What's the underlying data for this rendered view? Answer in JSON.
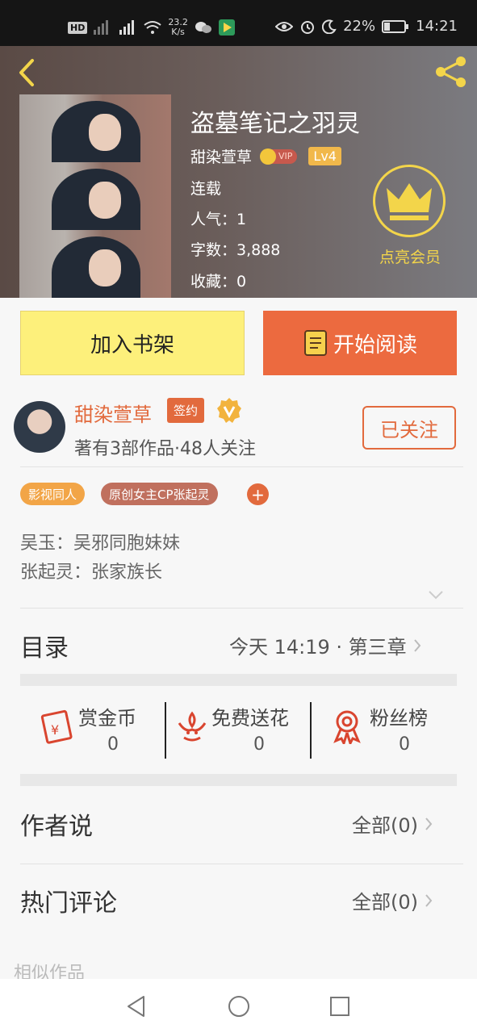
{
  "status_bar": {
    "hd_badge": "HD",
    "net_speed_value": "23.2",
    "net_speed_unit": "K/s",
    "battery": "22%",
    "time": "14:21"
  },
  "book": {
    "title": "盗墓笔记之羽灵",
    "author": "甜染萱草",
    "vip_badge": "VIP",
    "level": "Lv4",
    "status": "连载",
    "popularity": "人气：1",
    "word_count": "字数：3,888",
    "favorites": "收藏：0",
    "member_label": "点亮会员"
  },
  "actions": {
    "add_shelf": "加入书架",
    "start_reading": "开始阅读"
  },
  "author_card": {
    "name": "甜染萱草",
    "signed_badge": "签约",
    "stats": "著有3部作品·48人关注",
    "follow_label": "已关注"
  },
  "tags": [
    {
      "label": "影视同人",
      "color": "#f2a547"
    },
    {
      "label": "原创女主CP张起灵",
      "color": "#c0705e"
    }
  ],
  "tag_add": "+",
  "description": [
    "吴玉：吴邪同胞妹妹",
    "张起灵：张家族长"
  ],
  "toc": {
    "label": "目录",
    "latest": "今天 14:19 · 第三章"
  },
  "stats": [
    {
      "label": "赏金币",
      "value": "0",
      "icon": "red-envelope-icon"
    },
    {
      "label": "免费送花",
      "value": "0",
      "icon": "flower-icon"
    },
    {
      "label": "粉丝榜",
      "value": "0",
      "icon": "medal-icon"
    }
  ],
  "author_says": {
    "label": "作者说",
    "link": "全部(0)"
  },
  "hot_comments": {
    "label": "热门评论",
    "link": "全部(0)"
  },
  "similar_works": "相似作品",
  "colors": {
    "accent": "#e26a3d",
    "gold": "#f3d54a",
    "shelf_button": "#fdf07b"
  }
}
